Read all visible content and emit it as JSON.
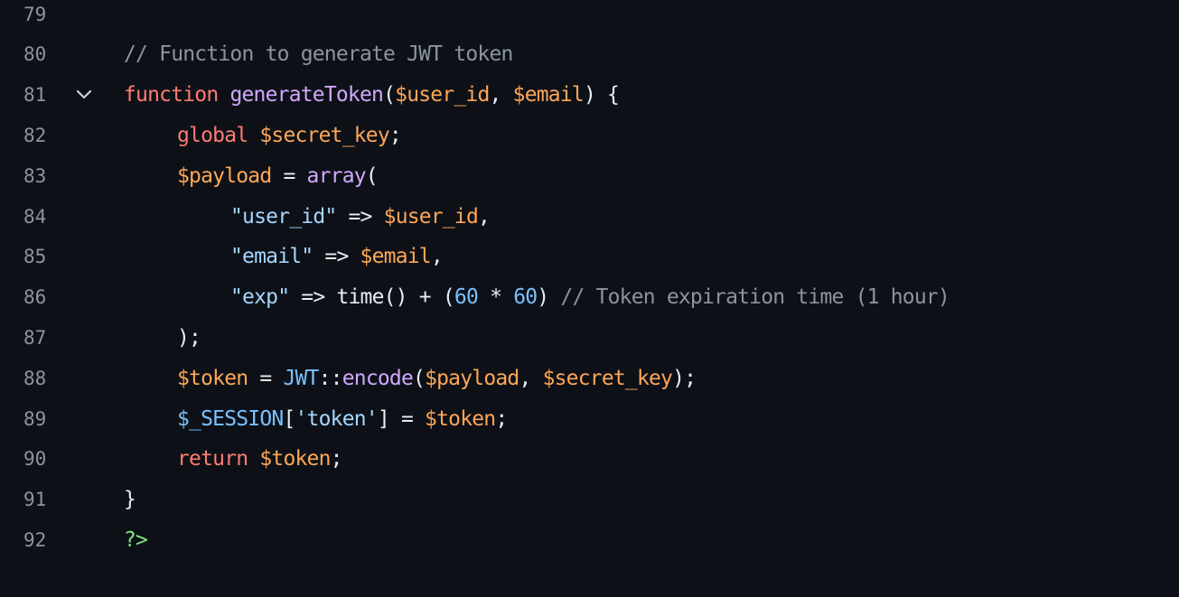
{
  "editor": {
    "theme_colors": {
      "background": "#0d1117",
      "line_number": "#8b949e",
      "comment": "#8b949e",
      "keyword": "#ff7b72",
      "function": "#d2a8ff",
      "variable": "#ffa657",
      "string": "#a5d6ff",
      "number": "#79c0ff",
      "plain": "#e6edf3",
      "tag": "#7ee787"
    },
    "fold_icon": "chevron-down-icon",
    "lines": [
      {
        "num": "79",
        "tokens": []
      },
      {
        "num": "80",
        "tokens": [
          {
            "t": "// Function to generate JWT token",
            "c": "comment"
          }
        ]
      },
      {
        "num": "81",
        "fold": true,
        "tokens": [
          {
            "t": "function",
            "c": "keyword"
          },
          {
            "t": " ",
            "c": "plain"
          },
          {
            "t": "generateToken",
            "c": "func"
          },
          {
            "t": "(",
            "c": "plain"
          },
          {
            "t": "$user_id",
            "c": "var"
          },
          {
            "t": ", ",
            "c": "plain"
          },
          {
            "t": "$email",
            "c": "var"
          },
          {
            "t": ") {",
            "c": "plain"
          }
        ]
      },
      {
        "num": "82",
        "tokens": [
          {
            "t": "global",
            "c": "keyword"
          },
          {
            "t": " ",
            "c": "plain"
          },
          {
            "t": "$secret_key",
            "c": "var"
          },
          {
            "t": ";",
            "c": "plain"
          }
        ]
      },
      {
        "num": "83",
        "tokens": [
          {
            "t": "$payload",
            "c": "var"
          },
          {
            "t": " = ",
            "c": "plain"
          },
          {
            "t": "array",
            "c": "func"
          },
          {
            "t": "(",
            "c": "plain"
          }
        ]
      },
      {
        "num": "84",
        "tokens": [
          {
            "t": "\"user_id\"",
            "c": "string"
          },
          {
            "t": " => ",
            "c": "plain"
          },
          {
            "t": "$user_id",
            "c": "var"
          },
          {
            "t": ",",
            "c": "plain"
          }
        ]
      },
      {
        "num": "85",
        "tokens": [
          {
            "t": "\"email\"",
            "c": "string"
          },
          {
            "t": " => ",
            "c": "plain"
          },
          {
            "t": "$email",
            "c": "var"
          },
          {
            "t": ",",
            "c": "plain"
          }
        ]
      },
      {
        "num": "86",
        "tokens": [
          {
            "t": "\"exp\"",
            "c": "string"
          },
          {
            "t": " => time() + (",
            "c": "plain"
          },
          {
            "t": "60",
            "c": "num"
          },
          {
            "t": " * ",
            "c": "plain"
          },
          {
            "t": "60",
            "c": "num"
          },
          {
            "t": ") ",
            "c": "plain"
          },
          {
            "t": "// Token expiration time (1 hour)",
            "c": "comment"
          }
        ]
      },
      {
        "num": "87",
        "tokens": [
          {
            "t": ");",
            "c": "plain"
          }
        ]
      },
      {
        "num": "88",
        "tokens": [
          {
            "t": "$token",
            "c": "var"
          },
          {
            "t": " = ",
            "c": "plain"
          },
          {
            "t": "JWT",
            "c": "const"
          },
          {
            "t": "::",
            "c": "plain"
          },
          {
            "t": "encode",
            "c": "func"
          },
          {
            "t": "(",
            "c": "plain"
          },
          {
            "t": "$payload",
            "c": "var"
          },
          {
            "t": ", ",
            "c": "plain"
          },
          {
            "t": "$secret_key",
            "c": "var"
          },
          {
            "t": ");",
            "c": "plain"
          }
        ]
      },
      {
        "num": "89",
        "tokens": [
          {
            "t": "$_SESSION",
            "c": "const"
          },
          {
            "t": "[",
            "c": "plain"
          },
          {
            "t": "'token'",
            "c": "string"
          },
          {
            "t": "] = ",
            "c": "plain"
          },
          {
            "t": "$token",
            "c": "var"
          },
          {
            "t": ";",
            "c": "plain"
          }
        ]
      },
      {
        "num": "90",
        "tokens": [
          {
            "t": "return",
            "c": "keyword"
          },
          {
            "t": " ",
            "c": "plain"
          },
          {
            "t": "$token",
            "c": "var"
          },
          {
            "t": ";",
            "c": "plain"
          }
        ]
      },
      {
        "num": "91",
        "tokens": [
          {
            "t": "}",
            "c": "plain"
          }
        ]
      },
      {
        "num": "92",
        "tokens": [
          {
            "t": "?>",
            "c": "tag"
          }
        ]
      }
    ]
  }
}
